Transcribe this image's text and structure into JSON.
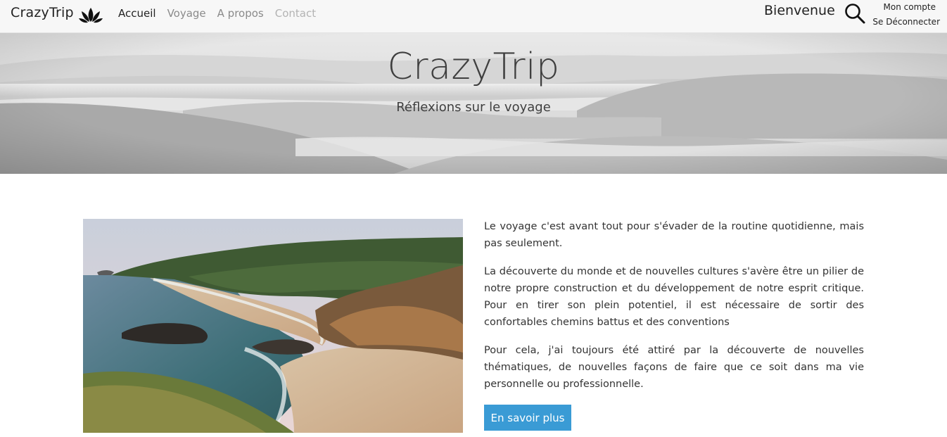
{
  "nav": {
    "brand": "CrazyTrip",
    "brand_logo_icon": "paw-lotus-icon",
    "links": [
      {
        "label": "Accueil"
      },
      {
        "label": "Voyage"
      },
      {
        "label": "A propos"
      },
      {
        "label": "Contact"
      }
    ],
    "welcome": "Bienvenue",
    "search_icon": "search-icon",
    "account_label": "Mon compte",
    "logout_label": "Se Déconnecter"
  },
  "hero": {
    "title": "CrazyTrip",
    "subtitle": "Réflexions sur le voyage"
  },
  "content": {
    "paragraphs": [
      "Le voyage c'est avant tout pour s'évader de la routine quotidienne, mais pas seulement.",
      "La découverte du monde et de nouvelles cultures s'avère être un pilier de notre propre construction et du développement de notre esprit critique. Pour en tirer son plein potentiel, il est nécessaire de sortir des confortables chemins battus et des conventions",
      "Pour cela, j'ai toujours été attiré par la découverte de nouvelles thématiques, de nouvelles façons de faire que ce soit dans ma vie personnelle ou professionnelle."
    ],
    "button_label": "En savoir plus"
  },
  "colors": {
    "navbar_bg": "#f7f7f7",
    "button_bg": "#3a9bd5",
    "text": "#333333"
  }
}
